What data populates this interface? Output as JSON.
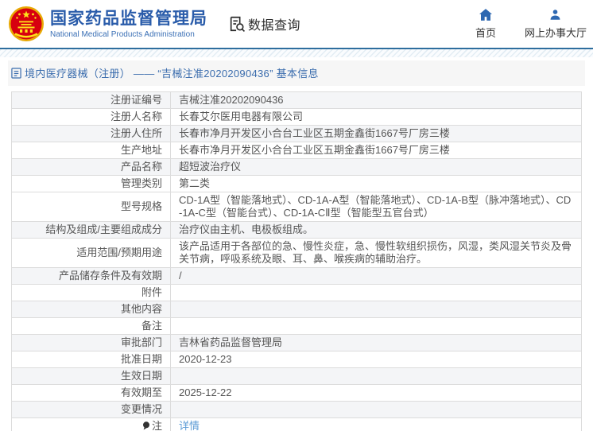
{
  "header": {
    "agency_name_zh": "国家药品监督管理局",
    "agency_name_en": "National Medical Products Administration",
    "nav_data_query": "数据查询",
    "nav_home": "首页",
    "nav_service_hall": "网上办事大厅"
  },
  "breadcrumb": {
    "text": "境内医疗器械（注册） —— “吉械注准20202090436” 基本信息"
  },
  "table": {
    "rows": [
      {
        "label": "注册证编号",
        "value": "吉械注准20202090436",
        "shaded": true
      },
      {
        "label": "注册人名称",
        "value": "长春艾尔医用电器有限公司",
        "shaded": false
      },
      {
        "label": "注册人住所",
        "value": "长春市净月开发区小合台工业区五期金鑫街1667号厂房三楼",
        "shaded": true
      },
      {
        "label": "生产地址",
        "value": "长春市净月开发区小合台工业区五期金鑫街1667号厂房三楼",
        "shaded": false
      },
      {
        "label": "产品名称",
        "value": "超短波治疗仪",
        "shaded": true
      },
      {
        "label": "管理类别",
        "value": "第二类",
        "shaded": false
      },
      {
        "label": "型号规格",
        "value": "CD-1A型（智能落地式）、CD-1A-A型（智能落地式）、CD-1A-B型（脉冲落地式）、CD-1A-C型（智能台式）、CD-1A-CⅡ型（智能型五官台式）",
        "shaded": false
      },
      {
        "label": "结构及组成/主要组成成分",
        "value": "治疗仪由主机、电极板组成。",
        "shaded": true
      },
      {
        "label": "适用范围/预期用途",
        "value": "该产品适用于各部位的急、慢性炎症，急、慢性软组织损伤，风湿，类风湿关节炎及骨关节病，呼吸系统及眼、耳、鼻、喉疾病的辅助治疗。",
        "shaded": false
      },
      {
        "label": "产品储存条件及有效期",
        "value": "/",
        "shaded": true
      },
      {
        "label": "附件",
        "value": "",
        "shaded": false
      },
      {
        "label": "其他内容",
        "value": "",
        "shaded": true
      },
      {
        "label": "备注",
        "value": "",
        "shaded": false
      },
      {
        "label": "审批部门",
        "value": "吉林省药品监督管理局",
        "shaded": true
      },
      {
        "label": "批准日期",
        "value": "2020-12-23",
        "shaded": false
      },
      {
        "label": "生效日期",
        "value": "",
        "shaded": true
      },
      {
        "label": "有效期至",
        "value": "2025-12-22",
        "shaded": false
      },
      {
        "label": "变更情况",
        "value": "",
        "shaded": true
      },
      {
        "label": "注",
        "value": "详情",
        "shaded": false,
        "icon": "note",
        "link": true
      }
    ]
  },
  "colors": {
    "brand_blue": "#2a5caa",
    "breadcrumb_blue": "#3a6cad",
    "link_blue": "#5b9bd5",
    "icon_blue": "#2e68b1",
    "stripe_line": "#2e6e9e",
    "shaded_row": "#f4f5f7",
    "border": "#dcdcdc",
    "emblem_red": "#d7000f",
    "emblem_gold": "#f5c518"
  }
}
